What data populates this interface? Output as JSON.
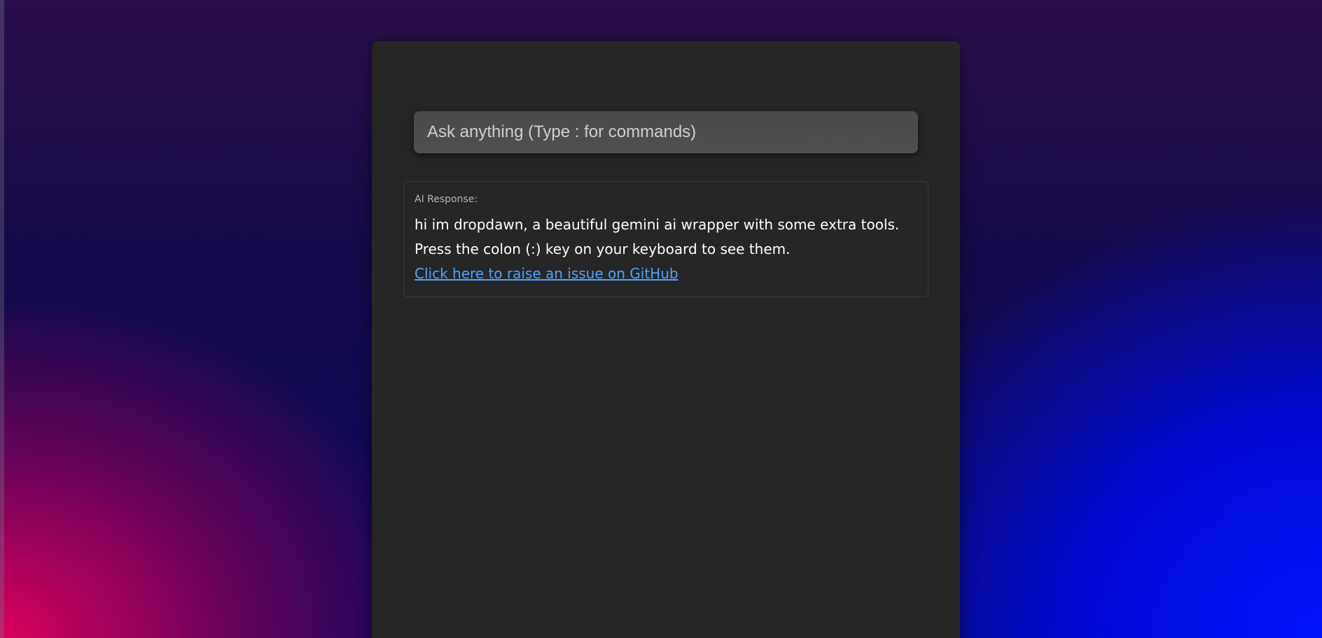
{
  "search": {
    "placeholder": "Ask anything (Type : for commands)",
    "value": ""
  },
  "response": {
    "label": "AI Response:",
    "lines": [
      "hi im dropdawn, a beautiful gemini ai wrapper with some extra tools.",
      "Press the colon (:) key on your keyboard to see them."
    ],
    "link_text": "Click here to raise an issue on GitHub"
  },
  "colors": {
    "panel": "#262626",
    "input": "#4d4d4d",
    "link": "#4da3ff",
    "text": "#ffffff",
    "label": "#b5b5b5",
    "background_left": "#e6005a",
    "background_right": "#0014ff"
  }
}
